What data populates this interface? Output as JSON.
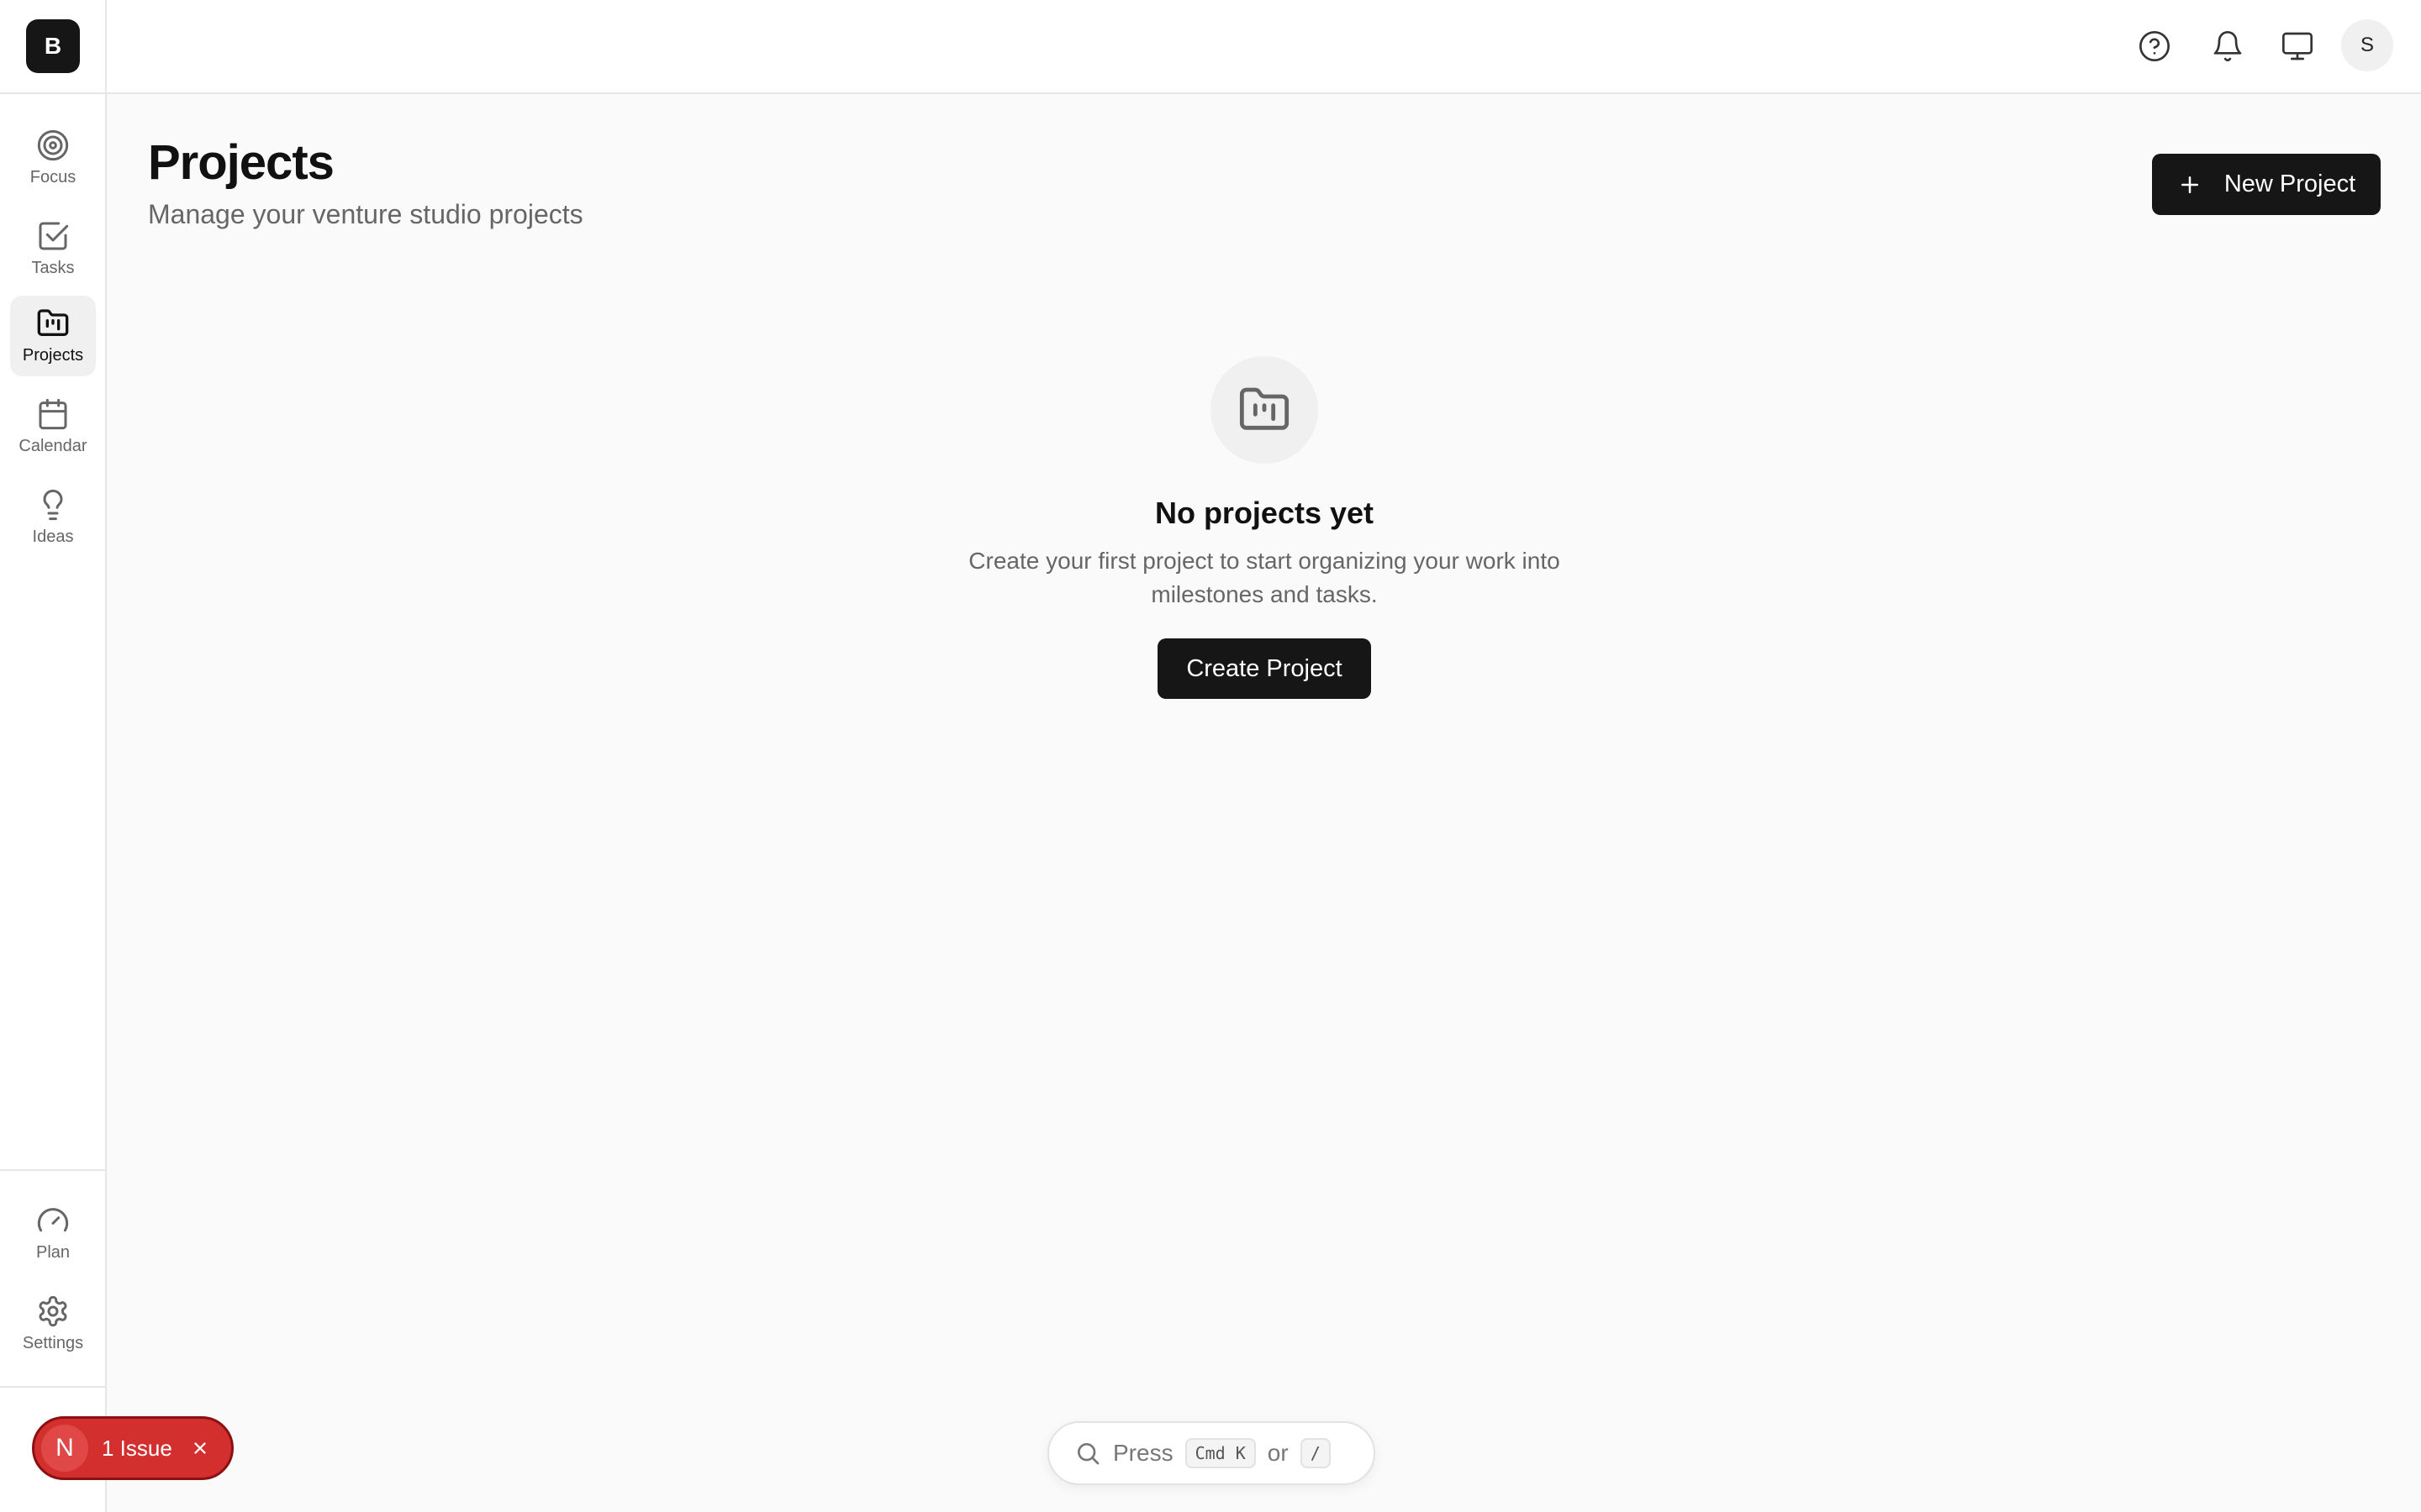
{
  "brand": {
    "initial": "B"
  },
  "sidebar": {
    "items": [
      {
        "label": "Focus",
        "icon": "target-icon",
        "active": false
      },
      {
        "label": "Tasks",
        "icon": "check-square-icon",
        "active": false
      },
      {
        "label": "Projects",
        "icon": "folder-kanban-icon",
        "active": true
      },
      {
        "label": "Calendar",
        "icon": "calendar-icon",
        "active": false
      },
      {
        "label": "Ideas",
        "icon": "lightbulb-icon",
        "active": false
      }
    ],
    "bottom_items": [
      {
        "label": "Plan",
        "icon": "gauge-icon"
      },
      {
        "label": "Settings",
        "icon": "gear-icon"
      }
    ]
  },
  "topbar": {
    "icons": [
      "help-icon",
      "bell-icon",
      "monitor-icon"
    ],
    "avatar_initial": "S"
  },
  "header": {
    "title": "Projects",
    "subtitle": "Manage your venture studio projects",
    "new_button_label": "New Project"
  },
  "empty_state": {
    "title": "No projects yet",
    "description": "Create your first project to start organizing your work into milestones and tasks.",
    "button_label": "Create Project"
  },
  "issue_badge": {
    "letter": "N",
    "label": "1 Issue"
  },
  "search": {
    "press": "Press",
    "key1": "Cmd K",
    "or": "or",
    "key2": "/"
  },
  "colors": {
    "primary": "#161616",
    "background": "#fafafa",
    "issue": "#d32f2f"
  }
}
